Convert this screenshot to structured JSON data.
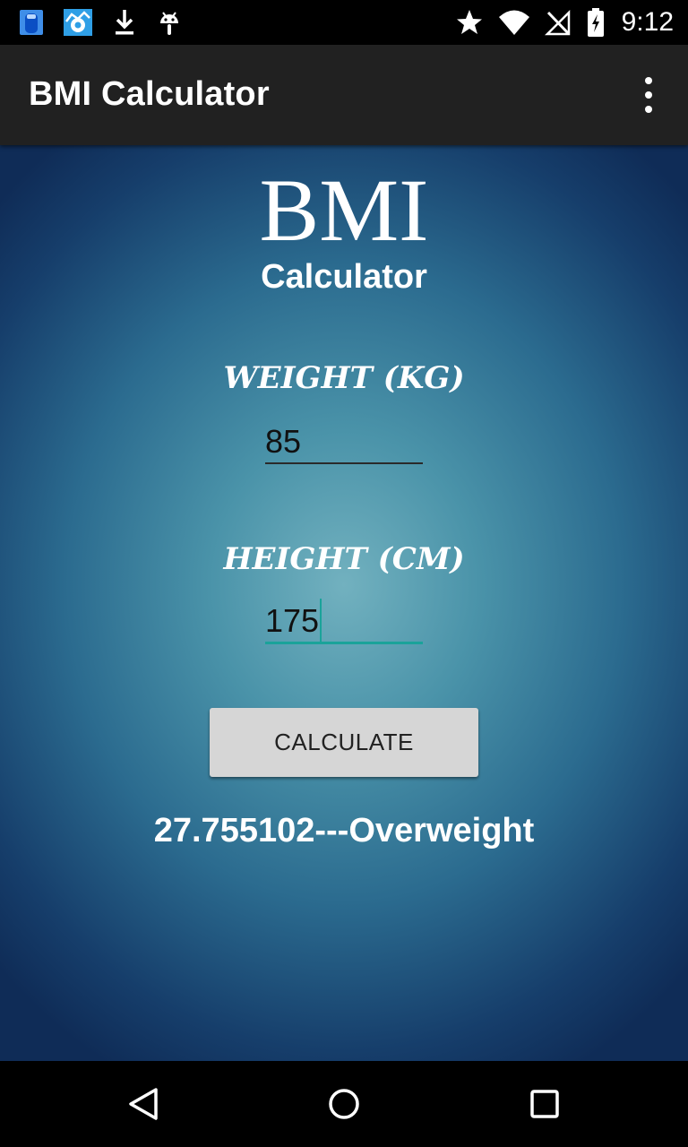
{
  "status_bar": {
    "time": "9:12",
    "left_icons": [
      "app-notification-icon",
      "gear-update-icon",
      "download-icon",
      "android-icon"
    ],
    "right_icons": [
      "star-icon",
      "wifi-icon",
      "no-signal-icon",
      "battery-charging-icon"
    ]
  },
  "app_bar": {
    "title": "BMI Calculator",
    "overflow_icon": "more-vert-icon"
  },
  "content": {
    "logo_big": "BMI",
    "logo_sub": "Calculator",
    "weight_label": "WEIGHT (KG)",
    "weight_value": "85",
    "height_label": "HEIGHT (CM)",
    "height_value": "175",
    "calculate_label": "CALCULATE",
    "result": "27.755102---Overweight"
  },
  "nav_bar": {
    "icons": [
      "back-icon",
      "home-icon",
      "recents-icon"
    ]
  },
  "colors": {
    "accent": "#1aa39a",
    "app_bar": "#212121",
    "button": "#d6d6d6"
  }
}
